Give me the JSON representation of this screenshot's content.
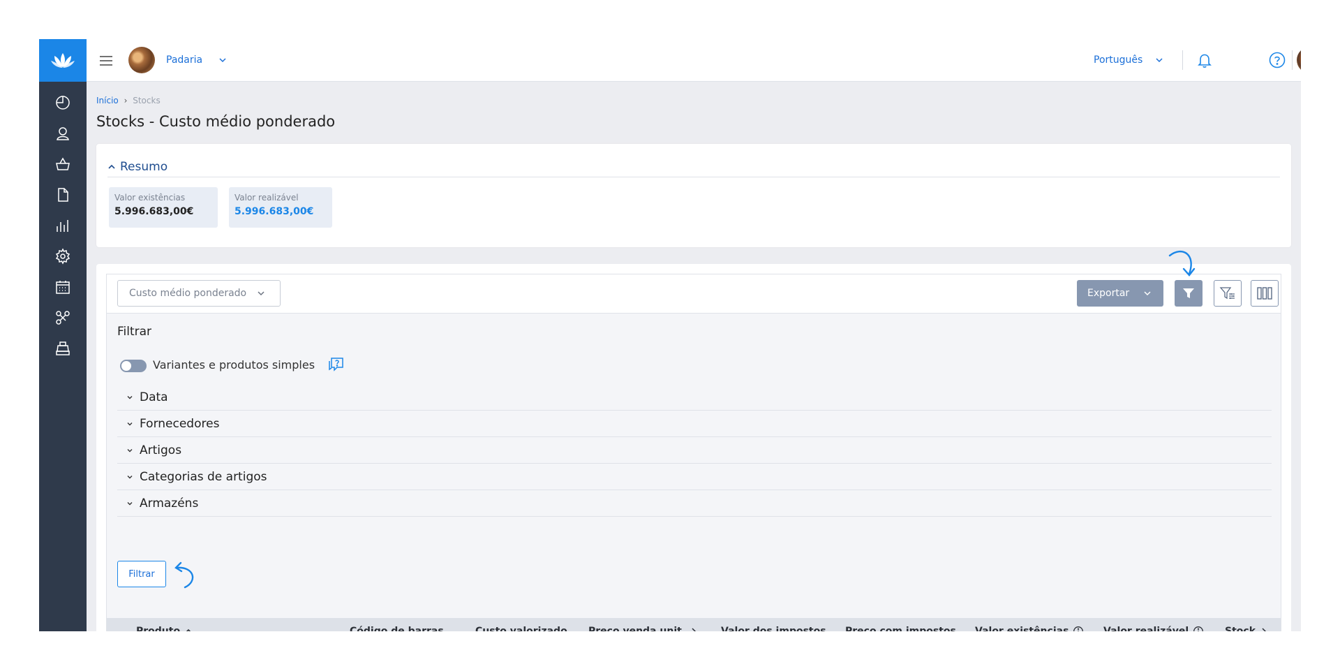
{
  "header": {
    "store_name": "Padaria",
    "language": "Português"
  },
  "breadcrumb": {
    "home": "Início",
    "separator": "›",
    "current": "Stocks"
  },
  "page_title": "Stocks - Custo médio ponderado",
  "resumo": {
    "title": "Resumo",
    "kpis": [
      {
        "label": "Valor existências",
        "value": "5.996.683,00€"
      },
      {
        "label": "Valor realizável",
        "value": "5.996.683,00€"
      }
    ]
  },
  "toolbar": {
    "method_select": "Custo médio ponderado",
    "export_label": "Exportar"
  },
  "filters": {
    "title": "Filtrar",
    "toggle_label": "Variantes e produtos simples",
    "sections": [
      "Data",
      "Fornecedores",
      "Artigos",
      "Categorias de artigos",
      "Armazéns"
    ],
    "apply_label": "Filtrar"
  },
  "table": {
    "columns": [
      "Produto",
      "Código de barras",
      "Custo valorizado",
      "Preço venda unit.",
      "Valor dos impostos",
      "Preço com impostos",
      "Valor existências",
      "Valor realizável",
      "Stock"
    ]
  },
  "colors": {
    "sidebar": "#2f3a4b",
    "brand": "#1b86e7",
    "button_gray": "#8797b0",
    "accent_text": "#1b6fd8"
  },
  "icons": {
    "sidebar": [
      "dashboard-icon",
      "user-icon",
      "basket-icon",
      "document-icon",
      "reports-icon",
      "settings-icon",
      "calendar-icon",
      "integrations-icon",
      "pos-icon"
    ]
  }
}
